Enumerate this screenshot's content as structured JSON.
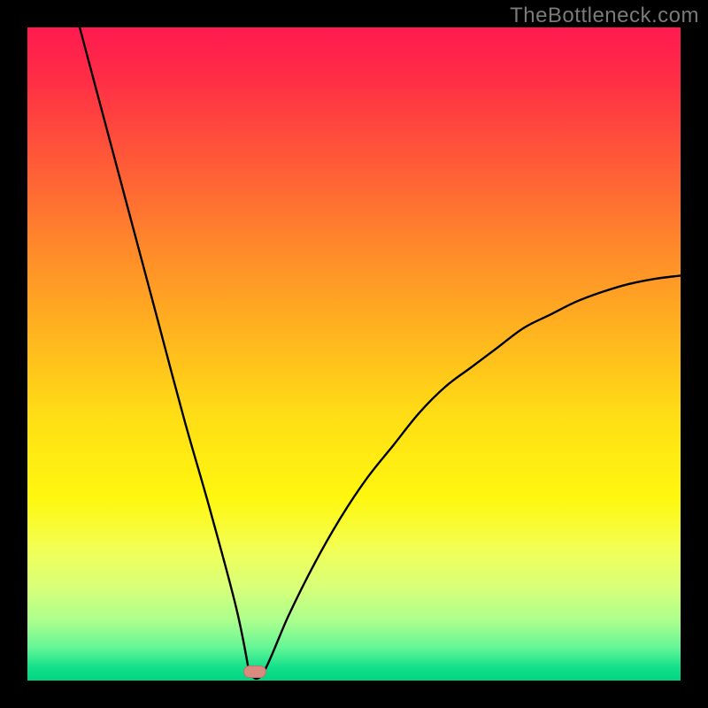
{
  "watermark": "TheBottleneck.com",
  "marker": {
    "cx_pct": 34.8,
    "cy_pct": 98.7
  },
  "chart_data": {
    "type": "line",
    "title": "",
    "xlabel": "",
    "ylabel": "",
    "xlim": [
      0,
      100
    ],
    "ylim": [
      0,
      100
    ],
    "grid": false,
    "legend": false,
    "background": "rainbow-vertical-gradient",
    "description": "V-shaped bottleneck curve: value descends from 100 at x≈8 to 0 near x≈35, then rises with decreasing slope toward ≈62 at x=100.",
    "series": [
      {
        "name": "bottleneck-curve",
        "x": [
          8,
          12,
          16,
          20,
          24,
          28,
          32,
          34,
          36,
          40,
          44,
          48,
          52,
          56,
          60,
          64,
          68,
          72,
          76,
          80,
          84,
          88,
          92,
          96,
          100
        ],
        "y": [
          100,
          85,
          70,
          55,
          40,
          26,
          11,
          1,
          1,
          10,
          18,
          25,
          31,
          36,
          41,
          45,
          48,
          51,
          54,
          56,
          58,
          59.5,
          60.7,
          61.5,
          62
        ]
      }
    ],
    "annotations": [
      {
        "type": "marker",
        "shape": "rounded-rect",
        "color": "#d98b80",
        "x": 34.8,
        "y": 1.3
      }
    ]
  }
}
